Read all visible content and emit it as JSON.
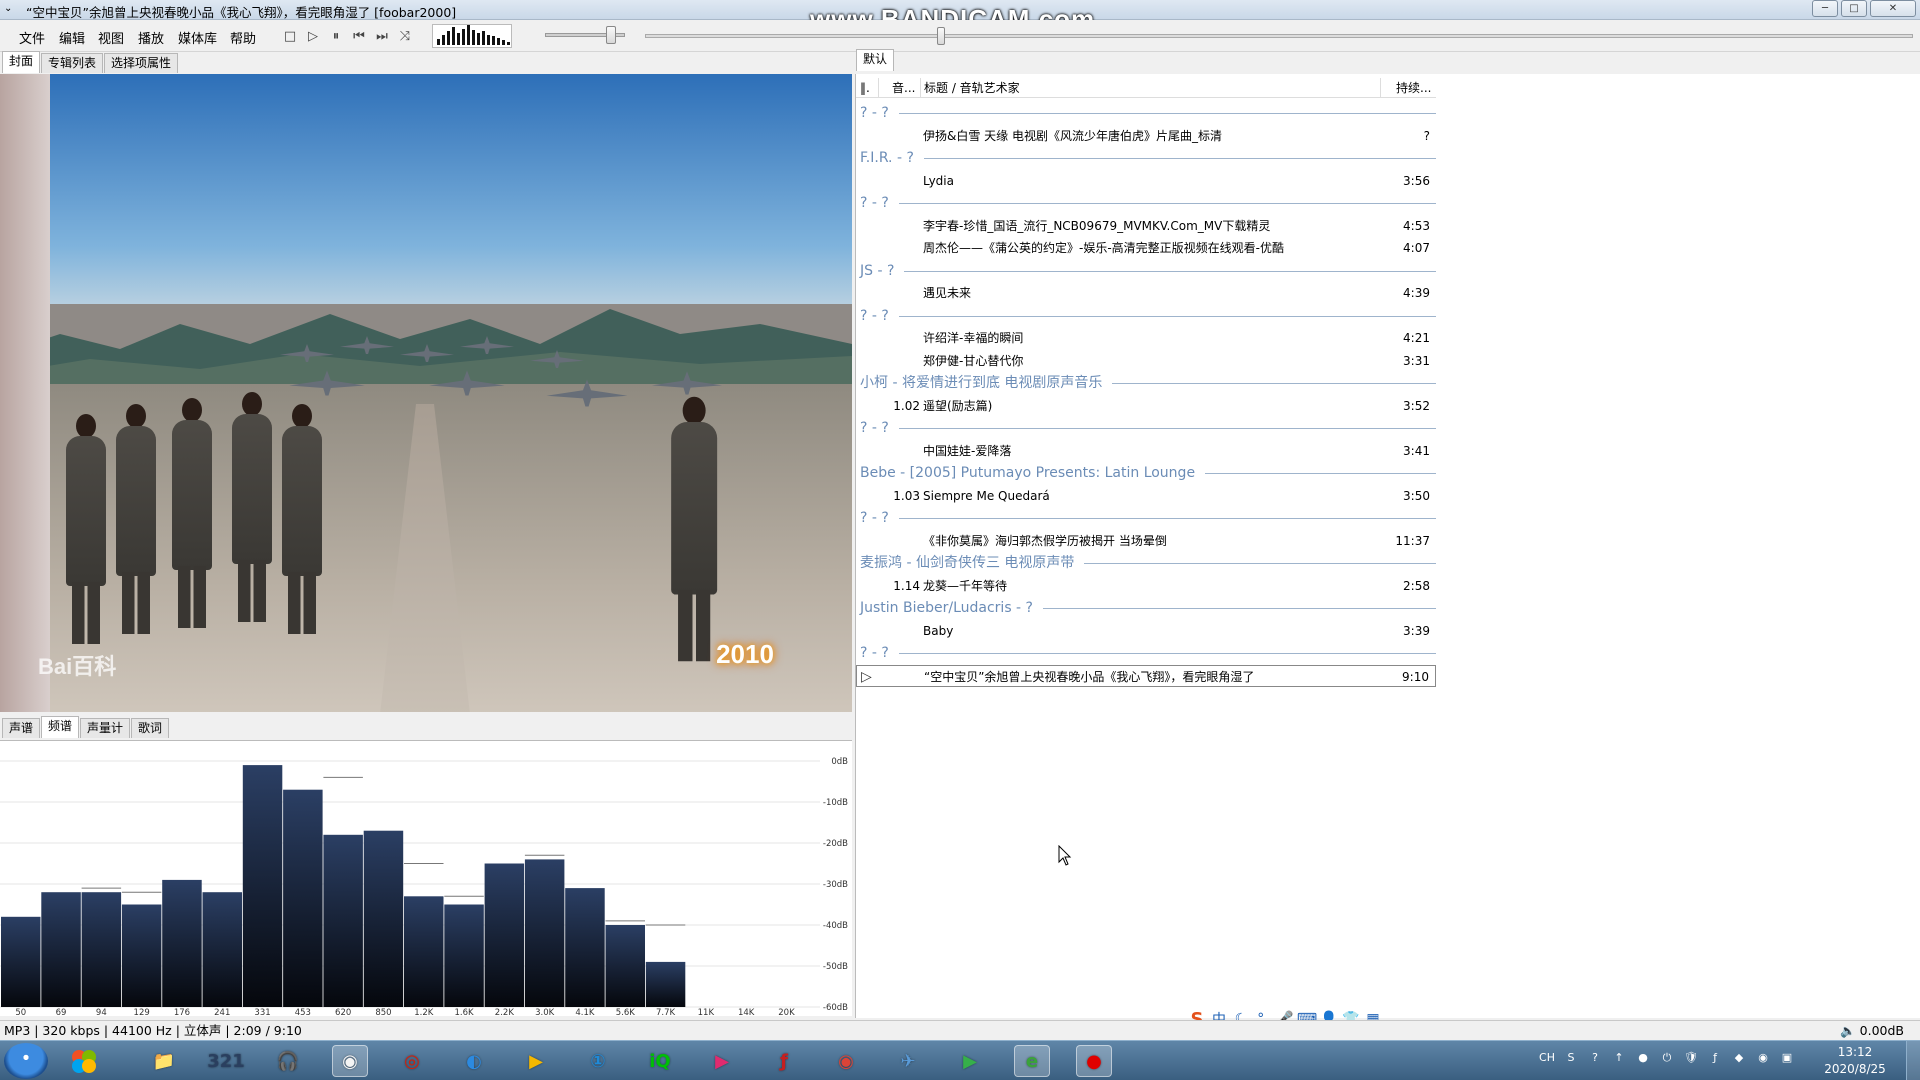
{
  "window": {
    "title": "“空中宝贝”余旭曾上央视春晚小品《我心飞翔》，看完眼角湿了  [foobar2000]",
    "watermark": "www.BANDICAM.com",
    "minimize": "─",
    "maximize": "□",
    "close": "✕"
  },
  "menu": [
    "文件",
    "编辑",
    "视图",
    "播放",
    "媒体库",
    "帮助"
  ],
  "toolbar": {
    "stop": "□",
    "play": "▷",
    "pause": "⏸",
    "prev": "⏮",
    "next": "⏭",
    "random": "⤨"
  },
  "left_tabs": [
    "封面",
    "专辑列表",
    "选择项属性"
  ],
  "cover": {
    "baidu_watermark": "Bai百科",
    "event_logo": "2010"
  },
  "vis_tabs": [
    "声谱",
    "频谱",
    "声量计",
    "歌词"
  ],
  "spectrum": {
    "x_labels": [
      "50",
      "69",
      "94",
      "129",
      "176",
      "241",
      "331",
      "453",
      "620",
      "850",
      "1.2K",
      "1.6K",
      "2.2K",
      "3.0K",
      "4.1K",
      "5.6K",
      "7.7K",
      "11K",
      "14K",
      "20K"
    ],
    "y_labels": [
      "0dB",
      "-10dB",
      "-20dB",
      "-30dB",
      "-40dB",
      "-50dB",
      "-60dB"
    ],
    "levels_db": [
      -38,
      -32,
      -32,
      -35,
      -29,
      -32,
      -1,
      -7,
      -18,
      -17,
      -33,
      -35,
      -25,
      -24,
      -31,
      -40,
      -49,
      -60,
      -60,
      -60
    ],
    "peaks_db": [
      -38,
      -32,
      -31,
      -32,
      -29,
      -32,
      -1,
      -7,
      -4,
      -17,
      -25,
      -33,
      -25,
      -23,
      -31,
      -39,
      -40,
      -60,
      -60,
      -60
    ]
  },
  "playlist": {
    "tab": "默认",
    "columns": {
      "playing": "‖.",
      "track_no": "音...",
      "title": "标题 / 音轨艺术家",
      "duration": "持续..."
    },
    "rows": [
      {
        "type": "group",
        "label": "? - ?"
      },
      {
        "type": "track",
        "num": "",
        "title": "伊扬&白雪 天缘 电视剧《风流少年唐伯虎》片尾曲_标清",
        "duration": "?"
      },
      {
        "type": "group",
        "label": "F.I.R. - ?"
      },
      {
        "type": "track",
        "num": "",
        "title": "Lydia",
        "duration": "3:56"
      },
      {
        "type": "group",
        "label": "? - ?"
      },
      {
        "type": "track",
        "num": "",
        "title": "李宇春-珍惜_国语_流行_NCB09679_MVMKV.Com_MV下载精灵",
        "duration": "4:53"
      },
      {
        "type": "track",
        "num": "",
        "title": "周杰伦——《蒲公英的约定》-娱乐-高清完整正版视频在线观看-优酷",
        "duration": "4:07"
      },
      {
        "type": "group",
        "label": "JS - ?"
      },
      {
        "type": "track",
        "num": "",
        "title": "遇见未来",
        "duration": "4:39"
      },
      {
        "type": "group",
        "label": "? - ?"
      },
      {
        "type": "track",
        "num": "",
        "title": "许绍洋-幸福的瞬间",
        "duration": "4:21"
      },
      {
        "type": "track",
        "num": "",
        "title": "郑伊健-甘心替代你",
        "duration": "3:31"
      },
      {
        "type": "group",
        "label": "小柯 - 将爱情进行到底 电视剧原声音乐"
      },
      {
        "type": "track",
        "num": "1.02",
        "title": "遥望(励志篇)",
        "duration": "3:52"
      },
      {
        "type": "group",
        "label": "? - ?"
      },
      {
        "type": "track",
        "num": "",
        "title": "中国娃娃-爱降落",
        "duration": "3:41"
      },
      {
        "type": "group",
        "label": "Bebe - [2005] Putumayo Presents: Latin Lounge"
      },
      {
        "type": "track",
        "num": "1.03",
        "title": "Siempre Me Quedará",
        "duration": "3:50"
      },
      {
        "type": "group",
        "label": "? - ?"
      },
      {
        "type": "track",
        "num": "",
        "title": "《非你莫属》海归郭杰假学历被揭开 当场晕倒",
        "duration": "11:37"
      },
      {
        "type": "group",
        "label": "麦振鸿 - 仙剑奇侠传三 电视原声带"
      },
      {
        "type": "track",
        "num": "1.14",
        "title": "龙葵—千年等待",
        "duration": "2:58"
      },
      {
        "type": "group",
        "label": "Justin Bieber/Ludacris - ?"
      },
      {
        "type": "track",
        "num": "",
        "title": "Baby",
        "duration": "3:39"
      },
      {
        "type": "group",
        "label": "? - ?"
      },
      {
        "type": "track",
        "num": "",
        "title": "“空中宝贝”余旭曾上央视春晚小品《我心飞翔》，看完眼角湿了",
        "duration": "9:10",
        "playing": true
      }
    ]
  },
  "status": {
    "left": "MP3 | 320 kbps | 44100 Hz | 立体声 | 2:09 / 9:10",
    "volume": "0.00dB"
  },
  "ime": [
    "S",
    "中",
    "☾",
    "°,",
    "🎤",
    "⌨",
    "👤",
    "👕",
    "▦"
  ],
  "taskbar": {
    "apps": [
      {
        "name": "file-explorer-icon",
        "glyph": "📁",
        "color": "#e2b44a"
      },
      {
        "name": "calendar-icon",
        "glyph": "321",
        "color": "#2a3f5f"
      },
      {
        "name": "headphones-icon",
        "glyph": "🎧",
        "color": "#3b3b3b"
      },
      {
        "name": "foobar-icon",
        "glyph": "◉",
        "color": "#f4f4f4",
        "active": true
      },
      {
        "name": "netease-music-icon",
        "glyph": "◎",
        "color": "#d81e06"
      },
      {
        "name": "media-player-icon",
        "glyph": "◐",
        "color": "#2c8ae0"
      },
      {
        "name": "potplayer-icon",
        "glyph": "▶",
        "color": "#f4b800"
      },
      {
        "name": "info-app-icon",
        "glyph": "①",
        "color": "#1f8ad8"
      },
      {
        "name": "iqiyi-icon",
        "glyph": "iQ",
        "color": "#00be06"
      },
      {
        "name": "youku-icon",
        "glyph": "▶",
        "color": "#e02b6f"
      },
      {
        "name": "flash-icon",
        "glyph": "ƒ",
        "color": "#c71f1f"
      },
      {
        "name": "chrome-icon",
        "glyph": "◉",
        "color": "#db4437"
      },
      {
        "name": "bird-app-icon",
        "glyph": "✈",
        "color": "#5a9bd8"
      },
      {
        "name": "video-player-icon",
        "glyph": "▶",
        "color": "#36b04a"
      },
      {
        "name": "360-browser-icon",
        "glyph": "e",
        "color": "#3aa33a",
        "active": true
      },
      {
        "name": "bandicam-icon",
        "glyph": "●",
        "color": "#e00000",
        "active": true
      }
    ],
    "tray": [
      "CH",
      "S",
      "?",
      "↑",
      "●",
      "⏻",
      "🛡",
      "ƒ",
      "◆",
      "◉",
      "▣"
    ],
    "time": "13:12",
    "date": "2020/8/25"
  }
}
